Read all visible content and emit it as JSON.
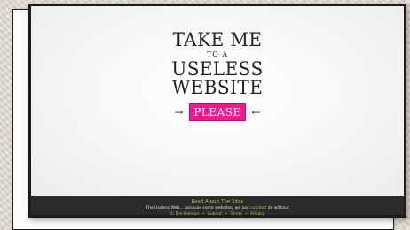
{
  "logo": {
    "line1": "TAKE ME",
    "line2": "TO A",
    "line3": "USELESS",
    "line4": "WEBSITE"
  },
  "cta": {
    "label": "PLEASE",
    "arrow_left": "→",
    "arrow_right": "←"
  },
  "footer": {
    "about_link": "Read About The Sites",
    "tagline_prefix": "The Useless Web... because some websites, we just",
    "tagline_highlight": "couldn't",
    "tagline_suffix": "do without",
    "copyright": "© Tim Holman",
    "submit": "Submit",
    "terms": "Terms",
    "privacy": "Privacy",
    "separator": "•"
  },
  "colors": {
    "accent": "#ef1a8e",
    "footer_link": "#a7c94a",
    "footer_bg": "#2a2a2a"
  }
}
